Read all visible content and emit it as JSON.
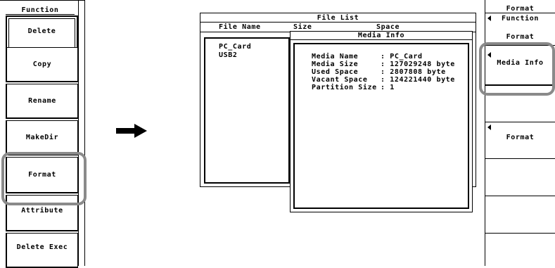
{
  "left_menu": {
    "title": "Function",
    "buttons": [
      "Delete",
      "Copy",
      "Rename",
      "MakeDir",
      "Format",
      "Attribute",
      "Delete Exec"
    ]
  },
  "file_list": {
    "title": "File List",
    "columns": {
      "name": "File Name",
      "size": "Size",
      "space": "Space"
    },
    "items": [
      "PC_Card",
      "USB2"
    ]
  },
  "media_info": {
    "title": "Media Info",
    "rows": [
      {
        "label": "Media Name",
        "value": ": PC_Card"
      },
      {
        "label": "Media Size",
        "value": ": 127029248 byte"
      },
      {
        "label": "Used Space",
        "value": ": 2807808 byte"
      },
      {
        "label": "Vacant Space",
        "value": ": 124221440 byte"
      },
      {
        "label": "Partition Size",
        "value": ": 1"
      }
    ]
  },
  "right_menu": {
    "title": "Format",
    "function_label": "Function",
    "function_value": "Format",
    "media_info_label": "Media Info",
    "format_label": "Format"
  },
  "colors": {
    "highlight": "#8a8a8a",
    "ink": "#000000",
    "background": "#ffffff"
  }
}
